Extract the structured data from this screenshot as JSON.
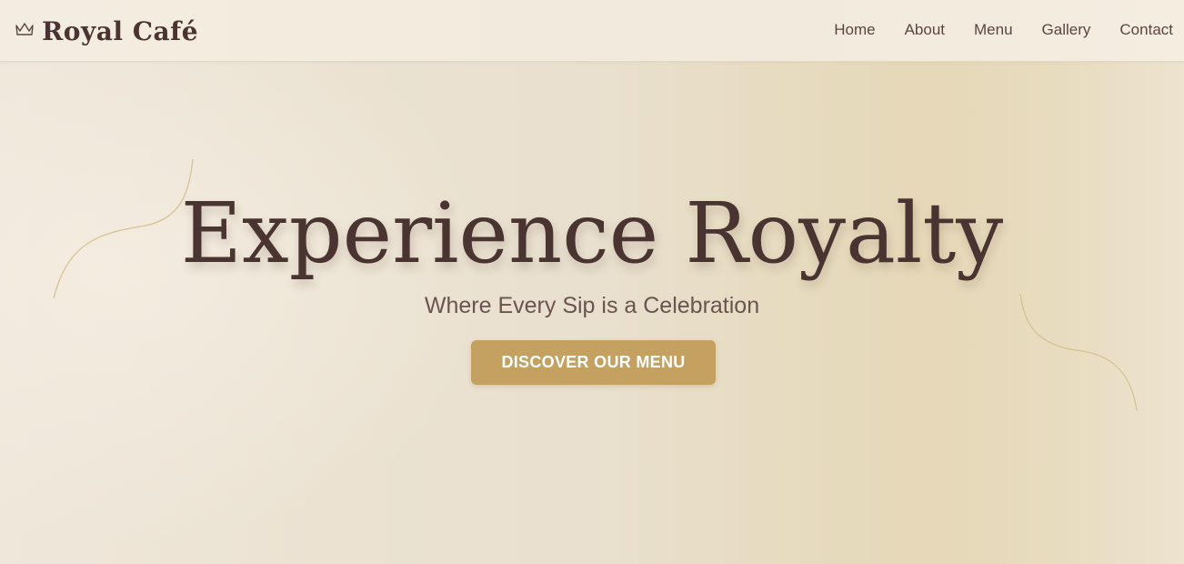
{
  "header": {
    "brand_name": "Royal Café",
    "brand_icon": "crown-icon",
    "nav": [
      {
        "label": "Home"
      },
      {
        "label": "About"
      },
      {
        "label": "Menu"
      },
      {
        "label": "Gallery"
      },
      {
        "label": "Contact"
      }
    ]
  },
  "hero": {
    "title": "Experience Royalty",
    "subtitle": "Where Every Sip is a Celebration",
    "cta_label": "DISCOVER OUR MENU"
  },
  "colors": {
    "text_primary": "#4a3431",
    "accent_gold": "#c4a160",
    "background": "#ebe2d2"
  }
}
